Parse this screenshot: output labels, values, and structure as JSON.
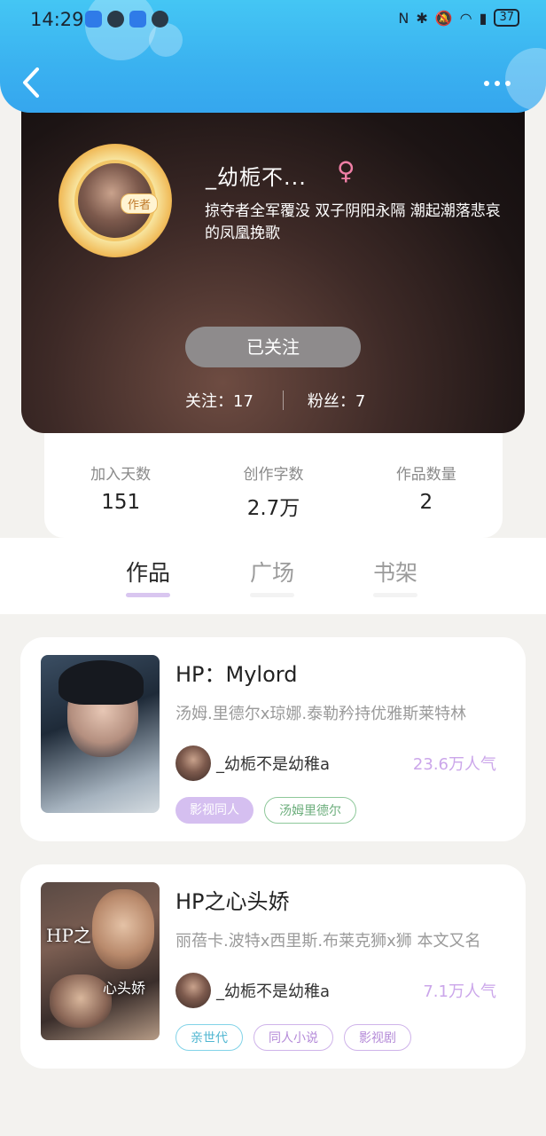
{
  "status_bar": {
    "time": "14:29",
    "battery": "37"
  },
  "header": {
    "back_icon": "chevron-left-icon",
    "more_icon": "more-dots-icon"
  },
  "profile": {
    "author_badge": "作者",
    "nickname": "_幼栀不...",
    "gender_symbol": "♀",
    "bio": "掠夺者全军覆没 双子阴阳永隔 潮起潮落悲哀的凤凰挽歌",
    "follow_button": "已关注",
    "following": "关注：17",
    "fans": "粉丝：7"
  },
  "stats": [
    {
      "label": "加入天数",
      "value": "151"
    },
    {
      "label": "创作字数",
      "value": "2.7万"
    },
    {
      "label": "作品数量",
      "value": "2"
    }
  ],
  "tabs": [
    {
      "label": "作品",
      "active": true
    },
    {
      "label": "广场",
      "active": false
    },
    {
      "label": "书架",
      "active": false
    }
  ],
  "books": [
    {
      "cover_text": "",
      "title": "HP：Mylord",
      "description": "汤姆.里德尔x琼娜.泰勒矜持优雅斯莱特林",
      "author": "_幼栀不是幼稚a",
      "popularity": "23.6万人气",
      "tags": [
        "影视同人",
        "汤姆里德尔"
      ]
    },
    {
      "cover_text_top": "HP之",
      "cover_text_bottom": "心头娇",
      "title": "HP之心头娇",
      "description": "丽蓓卡.波特x西里斯.布莱克狮x狮 本文又名",
      "author": "_幼栀不是幼稚a",
      "popularity": "7.1万人气",
      "tags": [
        "亲世代",
        "同人小说",
        "影视剧"
      ]
    }
  ],
  "colors": {
    "header_blue": "#3ab1f0",
    "accent_purple": "#cba6ea",
    "gender_pink": "#f07fa6"
  }
}
